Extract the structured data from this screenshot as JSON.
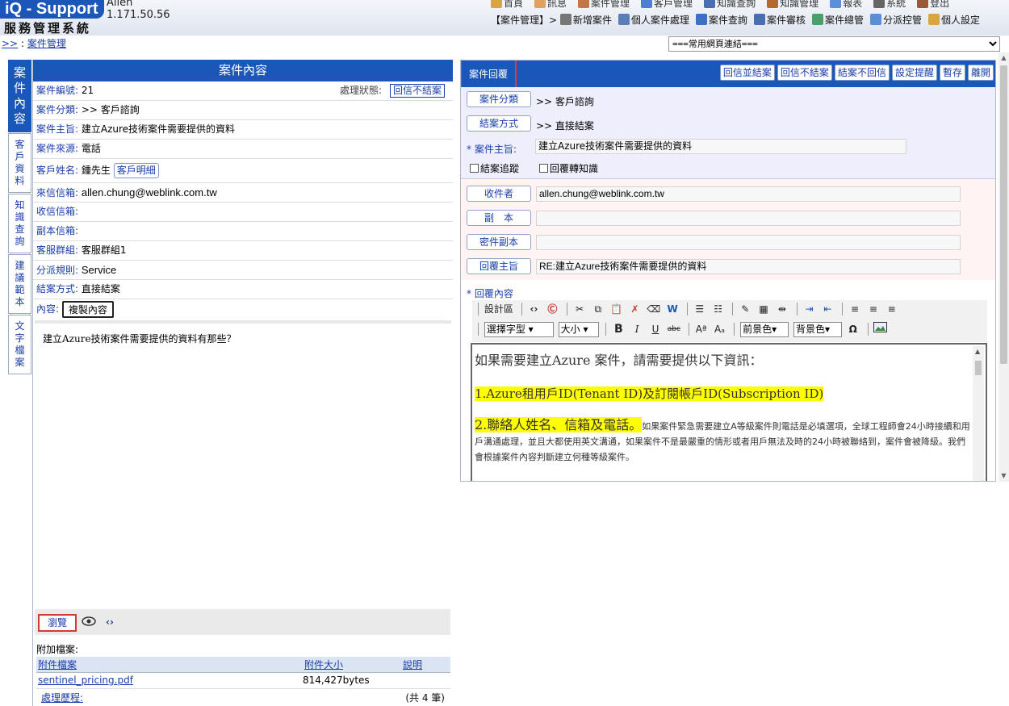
{
  "header": {
    "logo": "iQ - Support",
    "system_name": "服務管理系統",
    "user_name": "Allen",
    "ip": "1.171.50.56",
    "main_menu": [
      {
        "label": "首頁",
        "icon": "home-icon",
        "color": "#d9a441"
      },
      {
        "label": "訊息",
        "icon": "mail-icon",
        "color": "#e0a060"
      },
      {
        "label": "案件管理",
        "icon": "cases-icon",
        "color": "#c0774a"
      },
      {
        "label": "客戶管理",
        "icon": "customer-icon",
        "color": "#4f7fd0"
      },
      {
        "label": "知識查詢",
        "icon": "search-icon",
        "color": "#4a6fb0"
      },
      {
        "label": "知識管理",
        "icon": "knowledge-icon",
        "color": "#b5692e"
      },
      {
        "label": "報表",
        "icon": "report-icon",
        "color": "#5b8fd8"
      },
      {
        "label": "系統",
        "icon": "system-icon",
        "color": "#666666"
      },
      {
        "label": "登出",
        "icon": "logout-icon",
        "color": "#9a5a3a"
      }
    ],
    "case_menu_prefix": "【案件管理】>",
    "case_menu": [
      {
        "label": "新增案件",
        "icon": "new-case-icon",
        "color": "#777777"
      },
      {
        "label": "個人案件處理",
        "icon": "personal-case-icon",
        "color": "#5a7fb8"
      },
      {
        "label": "案件查詢",
        "icon": "case-search-icon",
        "color": "#3d6fc4"
      },
      {
        "label": "案件審核",
        "icon": "case-review-icon",
        "color": "#4a6fb0"
      },
      {
        "label": "案件總管",
        "icon": "case-admin-icon",
        "color": "#4aa06a"
      },
      {
        "label": "分派控管",
        "icon": "dispatch-icon",
        "color": "#5a8fd8"
      },
      {
        "label": "個人設定",
        "icon": "settings-icon",
        "color": "#d9a441"
      }
    ],
    "link_select": "===常用網頁連結===",
    "breadcrumb_prefix": ">>",
    "breadcrumb_sep": ":",
    "breadcrumb_link": "案件管理"
  },
  "side_tabs": [
    "案件內容",
    "客戶資料",
    "知識查詢",
    "建議範本",
    "文字檔案"
  ],
  "case": {
    "panel_title": "案件內容",
    "number_label": "案件編號:",
    "number": "21",
    "status_label": "處理狀態:",
    "status": "回信不結案",
    "category_label": "案件分類:",
    "category": ">> 客戶諮詢",
    "subject_label": "案件主旨:",
    "subject": "建立Azure技術案件需要提供的資料",
    "source_label": "案件來源:",
    "source": "電話",
    "customer_label": "客戶姓名:",
    "customer": "鍾先生",
    "customer_detail_btn": "客戶明細",
    "from_label": "來信信箱:",
    "from": "allen.chung@weblink.com.tw",
    "to_label": "收信信箱:",
    "to": "",
    "cc_label": "副本信箱:",
    "cc": "",
    "group_label": "客服群組:",
    "group": "客服群組1",
    "rule_label": "分派規則:",
    "rule": "Service",
    "close_label": "結案方式:",
    "close_method": "直接結案",
    "content_label": "內容:",
    "copy_btn": "複製內容",
    "content": "建立Azure技術案件需要提供的資料有那些？",
    "browse_btn": "瀏覽",
    "attach_label": "附加檔案:",
    "attach_headers": [
      "附件檔案",
      "附件大小",
      "說明"
    ],
    "attachments": [
      {
        "name": "sentinel_pricing.pdf",
        "size": "814,427bytes",
        "note": ""
      }
    ],
    "history_label": "處理歷程:",
    "history_count": "(共 4 筆)"
  },
  "reply": {
    "tab_label": "案件回覆",
    "actions": [
      "回信並結案",
      "回信不結案",
      "結案不回信",
      "設定提醒",
      "暫存",
      "離開"
    ],
    "category_btn": "案件分類",
    "category_val": ">> 客戶諮詢",
    "close_btn": "結案方式",
    "close_val": ">> 直接結案",
    "subject_label": "案件主旨:",
    "subject_val": "建立Azure技術案件需要提供的資料",
    "check_track": "結案追蹤",
    "check_knowledge": "回覆轉知識",
    "to_btn": "收件者",
    "to_val": "allen.chung@weblink.com.tw",
    "cc_btn": "副　本",
    "cc_val": "",
    "bcc_btn": "密件副本",
    "bcc_val": "",
    "reply_subject_btn": "回覆主旨",
    "reply_subject_val": "RE:建立Azure技術案件需要提供的資料",
    "content_label": "回覆內容",
    "toolbar": {
      "source_btn": "設計區",
      "font_select": "選擇字型",
      "size_select": "大小",
      "fg_select": "前景色",
      "bg_select": "背景色"
    },
    "body": {
      "intro": "如果需要建立Azure 案件，請需要提供以下資訊：",
      "item1": "1.Azure租用戶ID(Tenant ID)及訂閱帳戶ID(Subscription ID)",
      "item2": "2.聯絡人姓名、信箱及電話。",
      "note": "如果案件緊急需要建立A等級案件則電話是必填選項，全球工程師會24小時接續和用戶溝通處理，並且大都使用英文溝通，如果案件不是最嚴重的情形或者用戶無法及時的24小時被聯絡到，案件會被降級。我們會根據案件內容判斷建立何種等級案件。"
    }
  }
}
